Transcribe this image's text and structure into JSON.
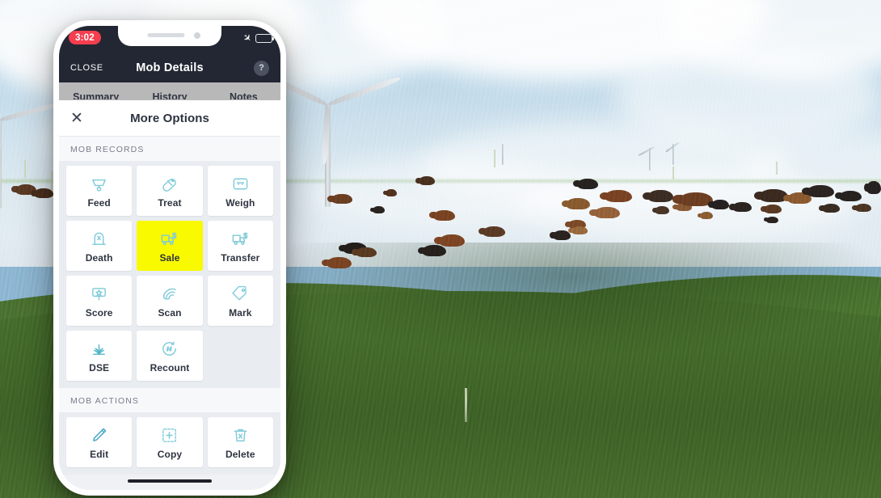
{
  "device": {
    "status_bar": {
      "recording_time": "3:02",
      "airplane_icon": "airplane-icon",
      "battery_icon": "battery-icon"
    },
    "nav_bar": {
      "close_label": "CLOSE",
      "title": "Mob Details",
      "help_label": "?"
    },
    "tabs": [
      {
        "label": "Summary"
      },
      {
        "label": "History"
      },
      {
        "label": "Notes"
      }
    ],
    "home_indicator": "home-indicator"
  },
  "sheet": {
    "close_glyph": "✕",
    "title": "More Options",
    "sections": [
      {
        "label": "MOB RECORDS",
        "tiles": [
          {
            "label": "Feed",
            "icon": "feed-trough-icon",
            "selected": false
          },
          {
            "label": "Treat",
            "icon": "pill-icon",
            "selected": false
          },
          {
            "label": "Weigh",
            "icon": "scale-icon",
            "selected": false
          },
          {
            "label": "Death",
            "icon": "gravestone-icon",
            "selected": false
          },
          {
            "label": "Sale",
            "icon": "truck-dollar-icon",
            "selected": true
          },
          {
            "label": "Transfer",
            "icon": "truck-dollar-icon",
            "selected": false
          },
          {
            "label": "Score",
            "icon": "sign-star-icon",
            "selected": false
          },
          {
            "label": "Scan",
            "icon": "ultrasound-icon",
            "selected": false
          },
          {
            "label": "Mark",
            "icon": "tag-icon",
            "selected": false
          },
          {
            "label": "DSE",
            "icon": "grass-icon",
            "selected": false
          },
          {
            "label": "Recount",
            "icon": "hash-refresh-icon",
            "selected": false
          }
        ]
      },
      {
        "label": "MOB ACTIONS",
        "tiles": [
          {
            "label": "Edit",
            "icon": "pencil-icon",
            "selected": false
          },
          {
            "label": "Copy",
            "icon": "copy-icon",
            "selected": false
          },
          {
            "label": "Delete",
            "icon": "trash-x-icon",
            "selected": false
          }
        ]
      }
    ]
  },
  "colors": {
    "accent_teal": "#7fcbd9",
    "highlight_yellow": "#f9f900",
    "nav_dark": "#222733",
    "recording_red": "#f63e4e",
    "text_dark": "#2e3441"
  },
  "background": {
    "scene": "pasture-with-cattle-and-wind-turbines"
  }
}
